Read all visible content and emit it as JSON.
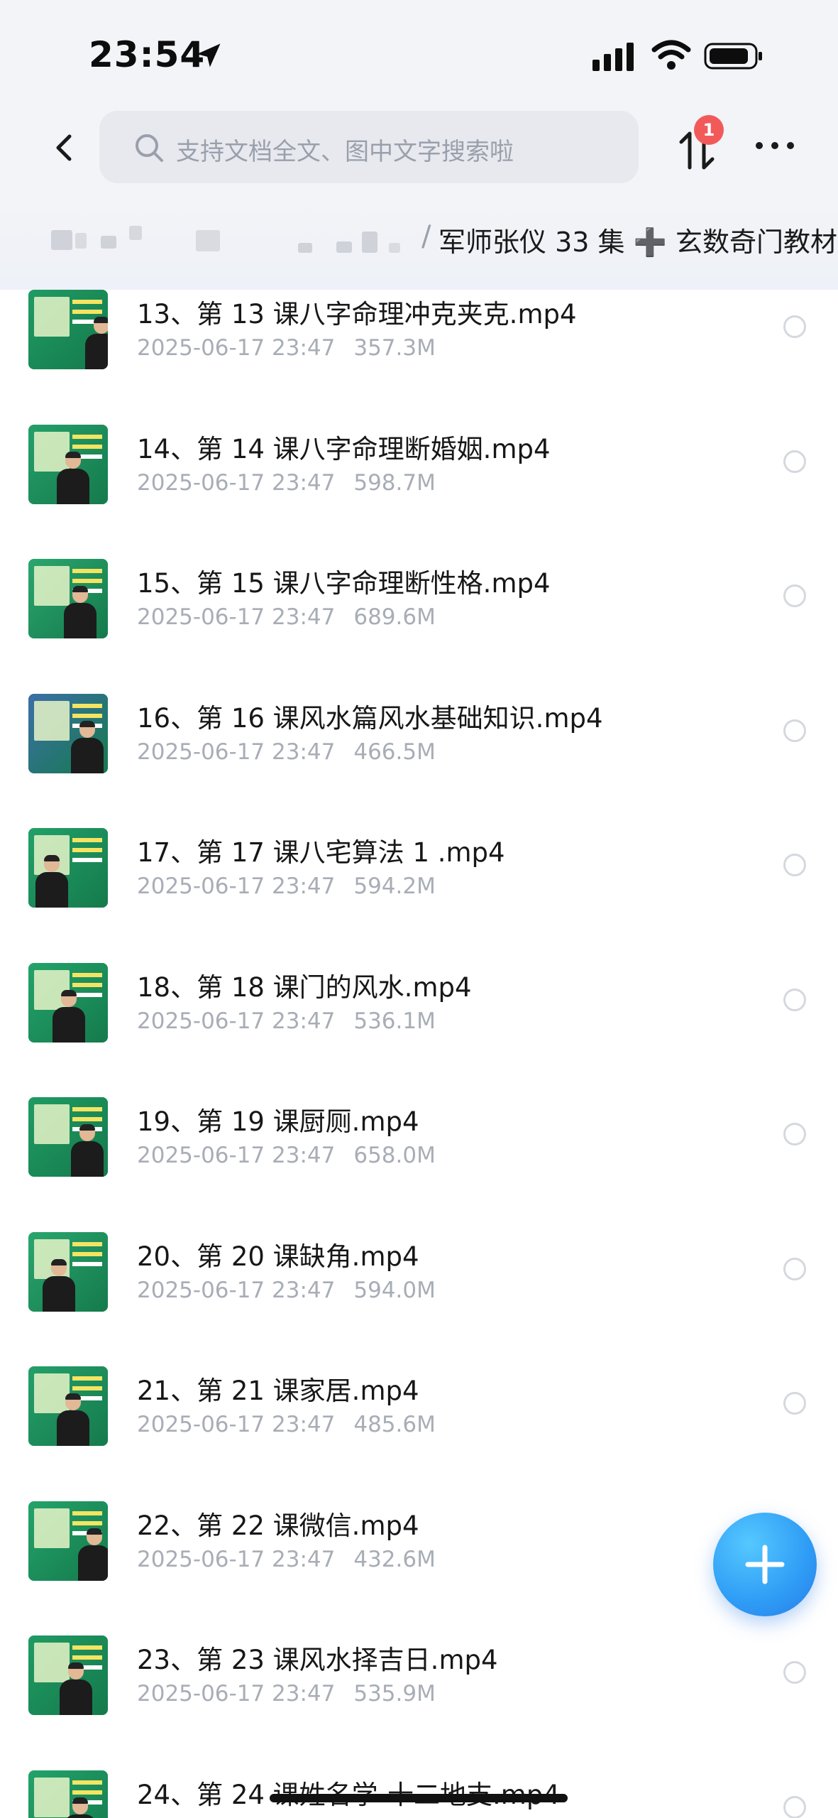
{
  "status_bar": {
    "time": "23:54",
    "icons": [
      "location-arrow-icon",
      "cellular-signal-icon",
      "wifi-icon",
      "battery-icon"
    ]
  },
  "header": {
    "back_icon": "chevron-left-icon",
    "search_placeholder": "支持文档全文、图中文字搜索啦",
    "transfer_icon": "transfer-arrows-icon",
    "transfer_badge": "1",
    "more_icon": "more-dots-icon"
  },
  "breadcrumb": {
    "separator": "/",
    "current": "军师张仪 33 集 ➕ 玄数奇门教材"
  },
  "files": [
    {
      "name": "13、第 13 课八字命理冲克夹克.mp4",
      "date": "2025-06-17 23:47",
      "size": "357.3M"
    },
    {
      "name": "14、第 14 课八字命理断婚姻.mp4",
      "date": "2025-06-17 23:47",
      "size": "598.7M"
    },
    {
      "name": "15、第 15 课八字命理断性格.mp4",
      "date": "2025-06-17 23:47",
      "size": "689.6M"
    },
    {
      "name": "16、第 16 课风水篇风水基础知识.mp4",
      "date": "2025-06-17 23:47",
      "size": "466.5M"
    },
    {
      "name": "17、第 17 课八宅算法 1 .mp4",
      "date": "2025-06-17 23:47",
      "size": "594.2M"
    },
    {
      "name": "18、第 18 课门的风水.mp4",
      "date": "2025-06-17 23:47",
      "size": "536.1M"
    },
    {
      "name": "19、第 19 课厨厕.mp4",
      "date": "2025-06-17 23:47",
      "size": "658.0M"
    },
    {
      "name": "20、第 20 课缺角.mp4",
      "date": "2025-06-17 23:47",
      "size": "594.0M"
    },
    {
      "name": "21、第 21 课家居.mp4",
      "date": "2025-06-17 23:47",
      "size": "485.6M"
    },
    {
      "name": "22、第 22 课微信.mp4",
      "date": "2025-06-17 23:47",
      "size": "432.6M"
    },
    {
      "name": "23、第 23 课风水择吉日.mp4",
      "date": "2025-06-17 23:47",
      "size": "535.9M"
    },
    {
      "name": "24、第 24 课姓名学-十二地支.mp4",
      "date": "",
      "size": ""
    }
  ],
  "fab_icon": "plus-icon",
  "colors": {
    "badge": "#f25a5a",
    "fab": "#2e9cf5",
    "meta_text": "#a8adb6"
  }
}
